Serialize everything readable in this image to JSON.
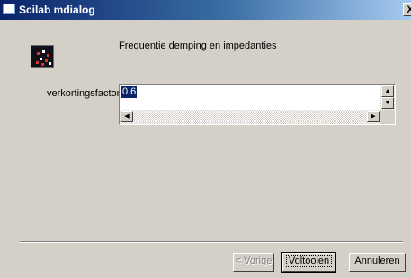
{
  "window": {
    "title": "Scilab mdialog",
    "close_label": "X"
  },
  "header": {
    "logo_icon": "scilab-logo-icon",
    "heading": "Frequentie demping en impedanties"
  },
  "form": {
    "field_label": "verkortingsfactor",
    "field_value": "0.6"
  },
  "scrollbars": {
    "up_icon": "scroll-up-arrow-icon",
    "down_icon": "scroll-down-arrow-icon",
    "left_icon": "scroll-left-arrow-icon",
    "right_icon": "scroll-right-arrow-icon"
  },
  "buttons": {
    "back_label": "< Vorige",
    "finish_label": "Voltooien",
    "cancel_label": "Annuleren"
  },
  "colors": {
    "titlebar": "#0a246a",
    "dialog_bg": "#d4d0c8",
    "selection": "#0a246a"
  }
}
